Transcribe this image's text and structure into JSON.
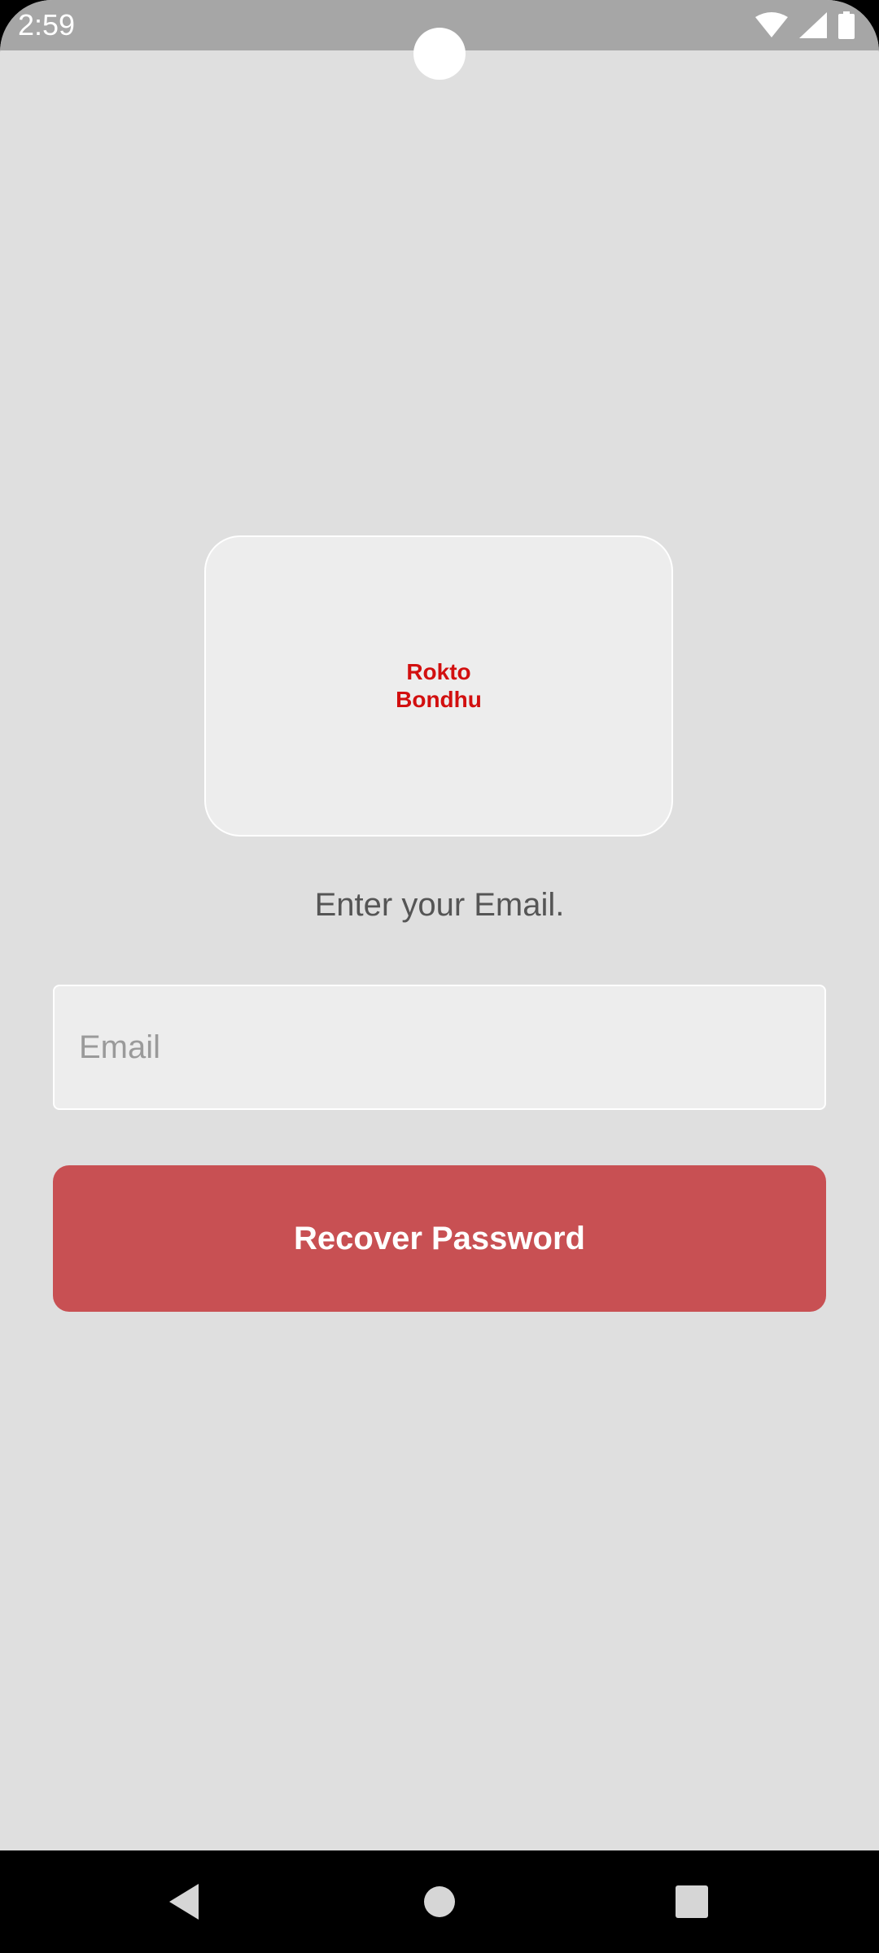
{
  "status_bar": {
    "time": "2:59",
    "icons": [
      "wifi-icon",
      "cellular-signal-icon",
      "battery-icon"
    ],
    "background": "#a6a6a6"
  },
  "logo": {
    "line1": "Rokto",
    "line2": "Bondhu",
    "color": "#d20f0f"
  },
  "main": {
    "prompt": "Enter your Email.",
    "email_placeholder": "Email",
    "email_value": "",
    "recover_button_label": "Recover Password",
    "accent": "#c85053",
    "background": "#dfdfdf"
  },
  "nav_bar": {
    "buttons": [
      "back-icon",
      "home-icon",
      "recents-icon"
    ]
  }
}
